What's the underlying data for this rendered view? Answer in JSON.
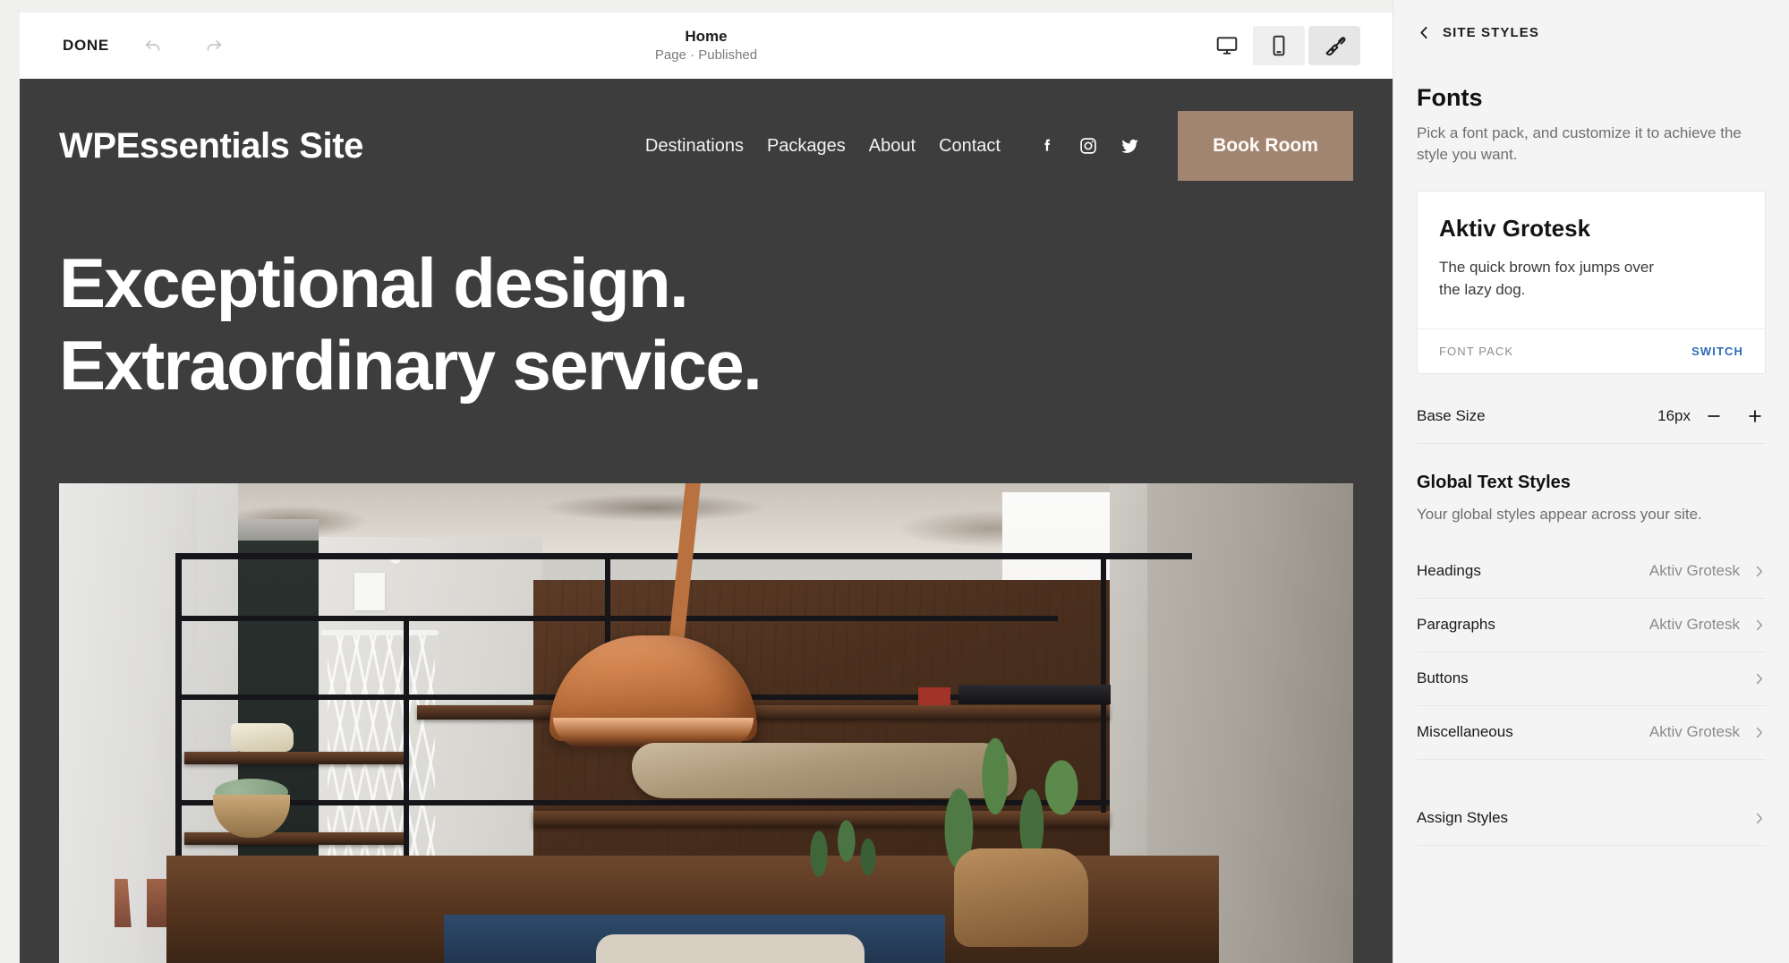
{
  "toolbar": {
    "done_label": "DONE",
    "undo_icon": "undo-icon",
    "redo_icon": "redo-icon",
    "page_title": "Home",
    "page_status": "Page · Published",
    "devices": [
      {
        "name": "desktop",
        "icon": "desktop-icon",
        "active": true
      },
      {
        "name": "mobile",
        "icon": "mobile-icon",
        "active": false
      }
    ],
    "style_tool": {
      "name": "brush",
      "icon": "paintbrush-icon",
      "active": true
    }
  },
  "site": {
    "brand": "WPEssentials Site",
    "nav_links": [
      "Destinations",
      "Packages",
      "About",
      "Contact"
    ],
    "socials": [
      "facebook-icon",
      "instagram-icon",
      "twitter-icon"
    ],
    "cta_label": "Book Room",
    "hero_line_1": "Exceptional design.",
    "hero_line_2": "Extraordinary service.",
    "colors": {
      "background": "#3d3d3d",
      "cta_background": "#a28571",
      "text": "#ffffff"
    }
  },
  "panel": {
    "back_label": "SITE STYLES",
    "back_icon": "chevron-left-icon",
    "fonts": {
      "title": "Fonts",
      "description": "Pick a font pack, and customize it to achieve the style you want.",
      "card": {
        "font_name": "Aktiv Grotesk",
        "pangram": "The quick brown fox jumps over the lazy dog.",
        "footer_label": "FONT PACK",
        "switch_label": "SWITCH"
      },
      "base_size": {
        "label": "Base Size",
        "value": "16px",
        "decrease_icon": "minus-icon",
        "increase_icon": "plus-icon"
      }
    },
    "global_text_styles": {
      "title": "Global Text Styles",
      "description": "Your global styles appear across your site.",
      "rows": [
        {
          "label": "Headings",
          "value": "Aktiv Grotesk"
        },
        {
          "label": "Paragraphs",
          "value": "Aktiv Grotesk"
        },
        {
          "label": "Buttons",
          "value": ""
        },
        {
          "label": "Miscellaneous",
          "value": "Aktiv Grotesk"
        }
      ]
    },
    "assign_styles": {
      "label": "Assign Styles"
    },
    "accent_color": "#2b6cb8"
  }
}
